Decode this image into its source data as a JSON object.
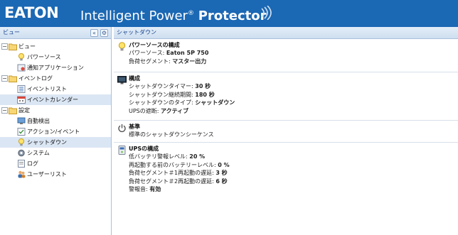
{
  "header": {
    "logo": "EATON",
    "title_main": "Intelligent Power",
    "title_reg": "®",
    "title_strong": "Protector"
  },
  "left_panel": {
    "title": "ビュー",
    "collapse_button": "«",
    "settings_button": "⚙",
    "tree": [
      {
        "label": "ビュー",
        "level": 0,
        "expanded": true,
        "icon": "folder-icon"
      },
      {
        "label": "パワーソース",
        "level": 1,
        "icon": "bulb-icon"
      },
      {
        "label": "通知アプリケーション",
        "level": 1,
        "icon": "notification-icon"
      },
      {
        "label": "イベントログ",
        "level": 0,
        "expanded": true,
        "icon": "folder-icon"
      },
      {
        "label": "イベントリスト",
        "level": 1,
        "icon": "event-list-icon"
      },
      {
        "label": "イベントカレンダー",
        "level": 1,
        "icon": "calendar-icon"
      },
      {
        "label": "設定",
        "level": 0,
        "expanded": true,
        "icon": "folder-icon"
      },
      {
        "label": "自動検出",
        "level": 1,
        "icon": "discovery-icon"
      },
      {
        "label": "アクション/イベント",
        "level": 1,
        "icon": "action-icon"
      },
      {
        "label": "シャットダウン",
        "level": 1,
        "icon": "shutdown-bulb-icon",
        "selected": true
      },
      {
        "label": "システム",
        "level": 1,
        "icon": "system-gear-icon"
      },
      {
        "label": "ログ",
        "level": 1,
        "icon": "log-icon"
      },
      {
        "label": "ユーザーリスト",
        "level": 1,
        "icon": "users-icon"
      }
    ]
  },
  "right_panel": {
    "title": "シャットダウン",
    "sections": [
      {
        "icon": "bulb-icon",
        "title": "パワーソースの構成",
        "rows": [
          {
            "label": "パワーソース: ",
            "value": "Eaton 5P 750"
          },
          {
            "label": "負荷セグメント: ",
            "value": "マスター出力"
          }
        ]
      },
      {
        "icon": "monitor-icon",
        "title": "構成",
        "rows": [
          {
            "label": "シャットダウンタイマー: ",
            "value": "30 秒"
          },
          {
            "label": "シャットダウン継続期間: ",
            "value": "180 秒"
          },
          {
            "label": "シャットダウンのタイプ: ",
            "value": "シャットダウン"
          },
          {
            "label": "UPSの遮断: ",
            "value": "アクティブ"
          }
        ]
      },
      {
        "icon": "power-icon",
        "title": "基準",
        "rows": [
          {
            "label": "標準のシャットダウンシーケンス",
            "value": ""
          }
        ]
      },
      {
        "icon": "ups-icon",
        "title": "UPSの構成",
        "rows": [
          {
            "label": "低バッテリ警報レベル: ",
            "value": "20 %"
          },
          {
            "label": "再起動する前のバッテリーレベル: ",
            "value": "0 %"
          },
          {
            "label": "負荷セグメント＃1再起動の遅延: ",
            "value": "3 秒"
          },
          {
            "label": "負荷セグメント＃2再起動の遅延: ",
            "value": "6 秒"
          },
          {
            "label": "警報音: ",
            "value": "有効"
          }
        ]
      }
    ]
  },
  "colors": {
    "header_bg": "#1b68b4",
    "panel_border": "#a9c1dc",
    "selected_row": "#dbe6f4"
  }
}
